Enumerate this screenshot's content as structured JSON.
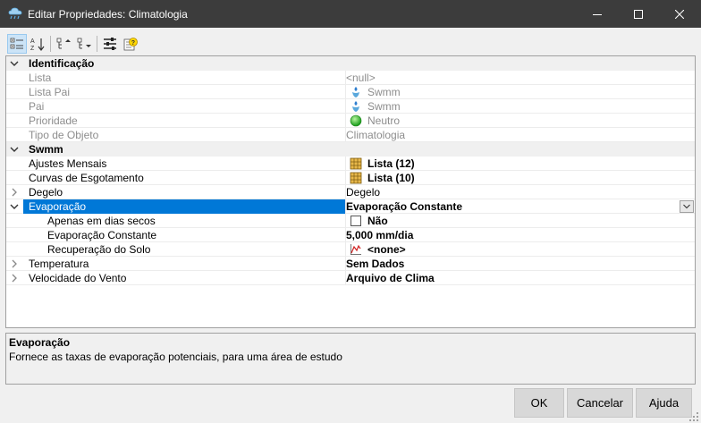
{
  "window": {
    "title": "Editar Propriedades: Climatologia",
    "app_icon": "cloud-rain-icon"
  },
  "toolbar": {
    "buttons": [
      {
        "icon": "categorized-view-icon",
        "active": true
      },
      {
        "icon": "sort-alphabetical-icon",
        "active": false
      },
      {
        "icon": "expand-all-icon",
        "active": false
      },
      {
        "icon": "collapse-all-icon",
        "active": false
      },
      {
        "icon": "property-settings-icon",
        "active": false
      },
      {
        "icon": "help-icon",
        "active": false
      }
    ]
  },
  "grid": {
    "rows": [
      {
        "type": "category",
        "name": "Identificação",
        "expanded": true
      },
      {
        "type": "property",
        "name": "Lista",
        "value": "<null>",
        "readonly": true
      },
      {
        "type": "property",
        "name": "Lista Pai",
        "value": "Swmm",
        "readonly": true,
        "icon": "swmm-icon"
      },
      {
        "type": "property",
        "name": "Pai",
        "value": "Swmm",
        "readonly": true,
        "icon": "swmm-icon"
      },
      {
        "type": "property",
        "name": "Prioridade",
        "value": "Neutro",
        "readonly": true,
        "icon": "green-circle-icon"
      },
      {
        "type": "property",
        "name": "Tipo de Objeto",
        "value": "Climatologia",
        "readonly": true
      },
      {
        "type": "category",
        "name": "Swmm",
        "expanded": true
      },
      {
        "type": "property",
        "name": "Ajustes Mensais",
        "value": "Lista (12)",
        "bold": true,
        "icon": "table-icon"
      },
      {
        "type": "property",
        "name": "Curvas de Esgotamento",
        "value": "Lista (10)",
        "bold": true,
        "icon": "table-icon"
      },
      {
        "type": "property",
        "name": "Degelo",
        "value": "Degelo",
        "expander": "collapsed"
      },
      {
        "type": "property",
        "name": "Evaporação",
        "value": "Evaporação Constante",
        "bold": true,
        "expander": "expanded",
        "selected": true
      },
      {
        "type": "property",
        "name": "Apenas em dias secos",
        "value": "Não",
        "bold": true,
        "sub": true,
        "icon": "checkbox-icon"
      },
      {
        "type": "property",
        "name": "Evaporação Constante",
        "value": "5,000 mm/dia",
        "bold": true,
        "sub": true
      },
      {
        "type": "property",
        "name": "Recuperação do Solo",
        "value": "<none>",
        "bold": true,
        "sub": true,
        "icon": "curve-chart-icon"
      },
      {
        "type": "property",
        "name": "Temperatura",
        "value": "Sem Dados",
        "bold": true,
        "expander": "collapsed"
      },
      {
        "type": "property",
        "name": "Velocidade do Vento",
        "value": "Arquivo de Clima",
        "bold": true,
        "expander": "collapsed"
      }
    ]
  },
  "description": {
    "title": "Evaporação",
    "text": "Fornece as taxas de evaporação potenciais, para uma área de estudo"
  },
  "footer": {
    "ok_label": "OK",
    "cancel_label": "Cancelar",
    "help_label": "Ajuda"
  },
  "colors": {
    "titlebar": "#3c3c3c",
    "selection": "#0078d7",
    "category_bg": "#f0f0f0"
  }
}
